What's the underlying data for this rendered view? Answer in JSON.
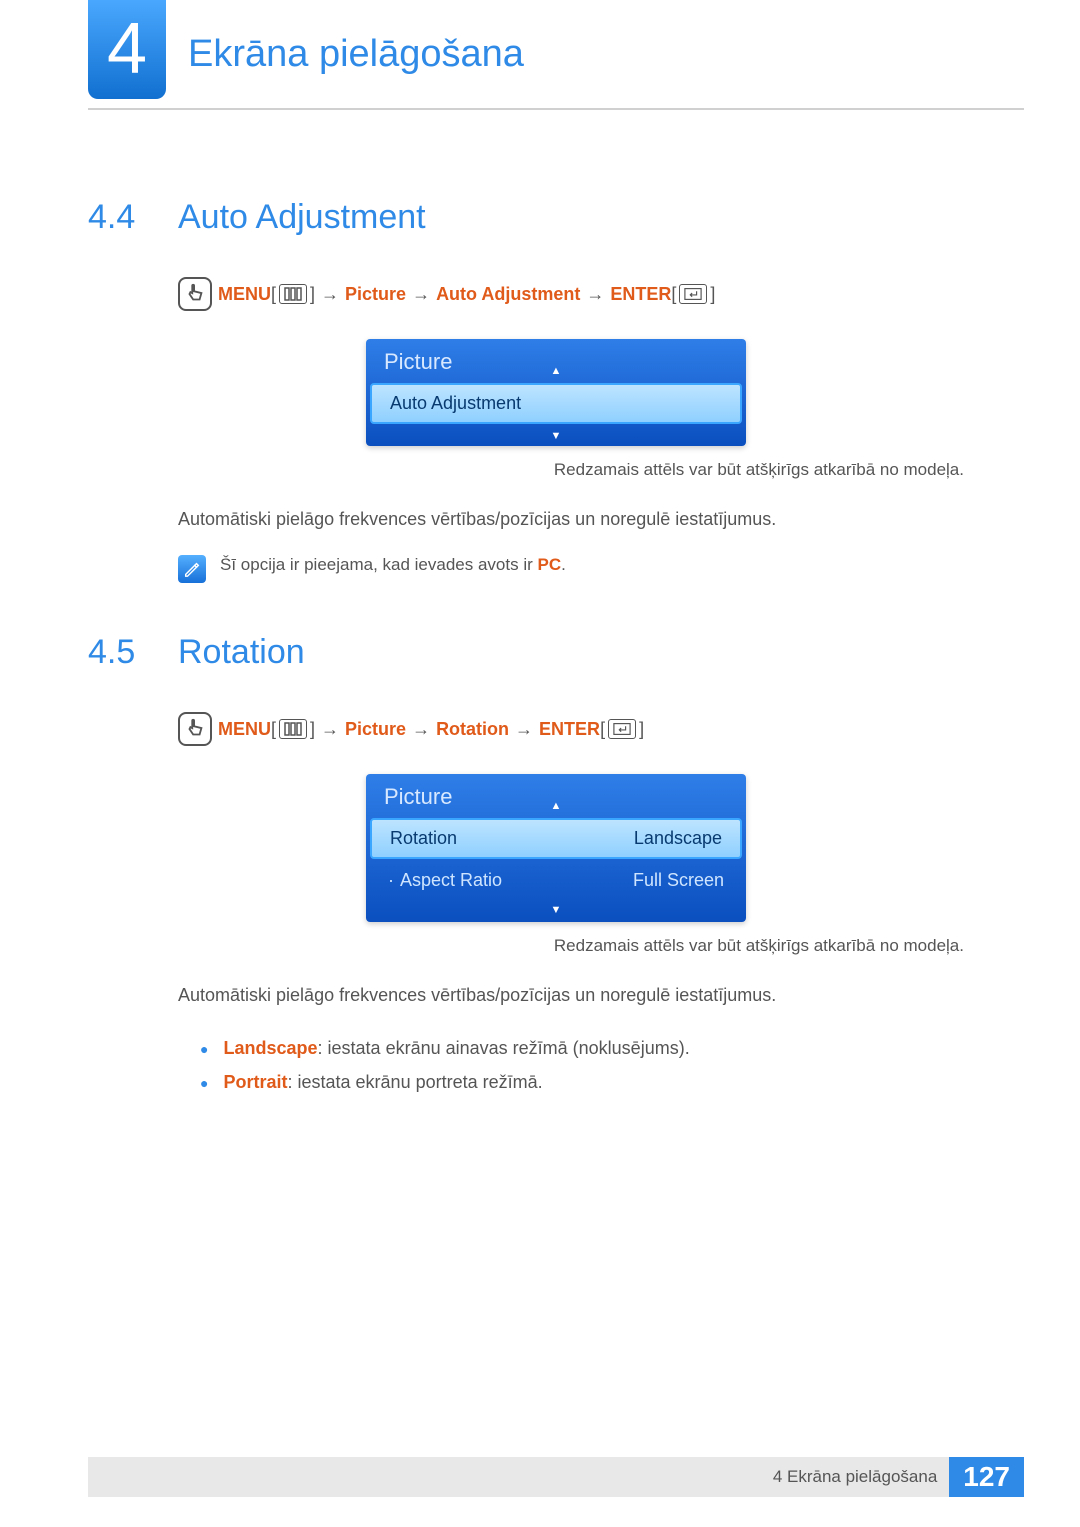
{
  "header": {
    "chapter_number": "4",
    "chapter_title": "Ekrāna pielāgošana"
  },
  "section44": {
    "num": "4.4",
    "title": "Auto Adjustment",
    "nav": {
      "menu": "MENU",
      "step1": "Picture",
      "step2": "Auto Adjustment",
      "enter": "ENTER"
    },
    "osd": {
      "title": "Picture",
      "row1": "Auto Adjustment"
    },
    "caption": "Redzamais attēls var būt atšķirīgs atkarībā no modeļa.",
    "body": "Automātiski pielāgo frekvences vērtības/pozīcijas un noregulē iestatījumus.",
    "note_pre": "Šī opcija ir pieejama, kad ievades avots ir ",
    "note_em": "PC",
    "note_post": "."
  },
  "section45": {
    "num": "4.5",
    "title": "Rotation",
    "nav": {
      "menu": "MENU",
      "step1": "Picture",
      "step2": "Rotation",
      "enter": "ENTER"
    },
    "osd": {
      "title": "Picture",
      "row1_label": "Rotation",
      "row1_value": "Landscape",
      "row2_label": "Aspect Ratio",
      "row2_value": "Full Screen"
    },
    "caption": "Redzamais attēls var būt atšķirīgs atkarībā no modeļa.",
    "body": "Automātiski pielāgo frekvences vērtības/pozīcijas un noregulē iestatījumus.",
    "bullets": {
      "b1_em": "Landscape",
      "b1_text": ": iestata ekrānu ainavas režīmā (noklusējums).",
      "b2_em": "Portrait",
      "b2_text": ": iestata ekrānu portreta režīmā."
    }
  },
  "footer": {
    "text": "4 Ekrāna pielāgošana",
    "page": "127"
  }
}
